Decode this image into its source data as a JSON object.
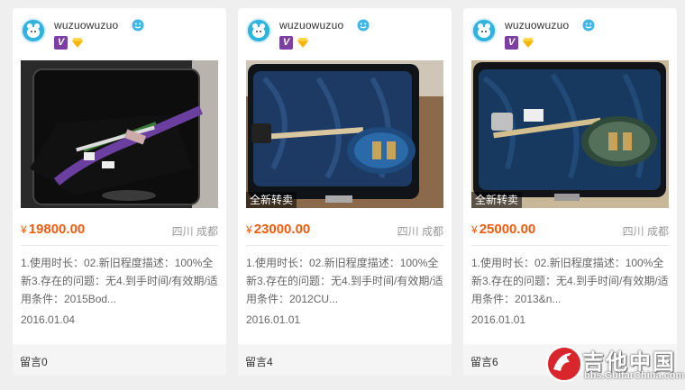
{
  "listings": [
    {
      "username": "wuzuowuzuo",
      "badge_v": "V",
      "new_tag": "",
      "price_symbol": "¥",
      "price": "19800.00",
      "location": "四川 成都",
      "description": "1.使用时长：02.新旧程度描述：100%全新3.存在的问题：无4.到手时间/有效期/适用条件：2015Bod...",
      "date": "2016.01.04",
      "comments": "留言0"
    },
    {
      "username": "wuzuowuzuo",
      "badge_v": "V",
      "new_tag": "全新转卖",
      "price_symbol": "¥",
      "price": "23000.00",
      "location": "四川 成都",
      "description": "1.使用时长：02.新旧程度描述：100%全新3.存在的问题：无4.到手时间/有效期/适用条件：2012CU...",
      "date": "2016.01.01",
      "comments": "留言4"
    },
    {
      "username": "wuzuowuzuo",
      "badge_v": "V",
      "new_tag": "全新转卖",
      "price_symbol": "¥",
      "price": "25000.00",
      "location": "四川 成都",
      "description": "1.使用时长：02.新旧程度描述：100%全新3.存在的问题：无4.到手时间/有效期/适用条件：2013&n...",
      "date": "2016.01.01",
      "comments": "留言6"
    }
  ],
  "watermark": {
    "title": "吉他中国",
    "url": "bbs.GuitarChina.com"
  },
  "colors": {
    "price": "#f25a0d",
    "badge_v": "#7e3fa3",
    "avatar": "#2fb3df",
    "page_bg": "#efefef"
  },
  "icons": {
    "avatar": "avatar-icon",
    "smile": "smile-icon",
    "vip": "v-badge-icon",
    "diamond": "diamond-icon"
  }
}
